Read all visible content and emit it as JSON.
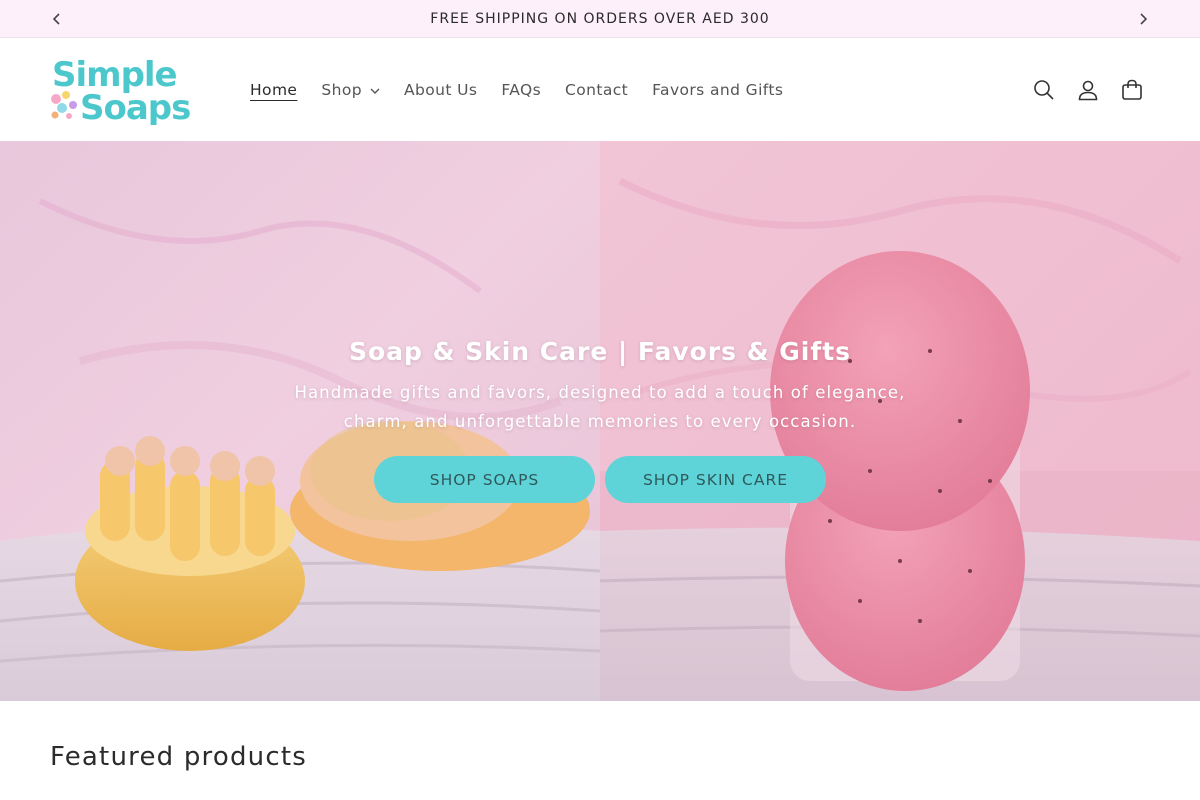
{
  "announcement": {
    "text": "FREE SHIPPING ON ORDERS OVER AED 300",
    "prev_icon": "chevron-left-icon",
    "next_icon": "chevron-right-icon"
  },
  "header": {
    "logo_text": "Simple Soaps",
    "nav": [
      {
        "label": "Home",
        "active": true
      },
      {
        "label": "Shop",
        "has_dropdown": true
      },
      {
        "label": "About Us"
      },
      {
        "label": "FAQs"
      },
      {
        "label": "Contact"
      },
      {
        "label": "Favors and Gifts"
      }
    ],
    "icons": [
      "search-icon",
      "account-icon",
      "cart-icon"
    ]
  },
  "hero": {
    "title": "Soap & Skin Care | Favors & Gifts",
    "subtitle": "Handmade gifts and favors, designed to add a touch of elegance, charm, and unforgettable memories to every occasion.",
    "buttons": [
      {
        "label": "SHOP SOAPS"
      },
      {
        "label": "SHOP SKIN CARE"
      }
    ]
  },
  "featured": {
    "title": "Featured products"
  },
  "colors": {
    "accent": "#5ed4d8",
    "logo_teal": "#4cc8cc",
    "announcement_bg": "#fdf0fb"
  }
}
